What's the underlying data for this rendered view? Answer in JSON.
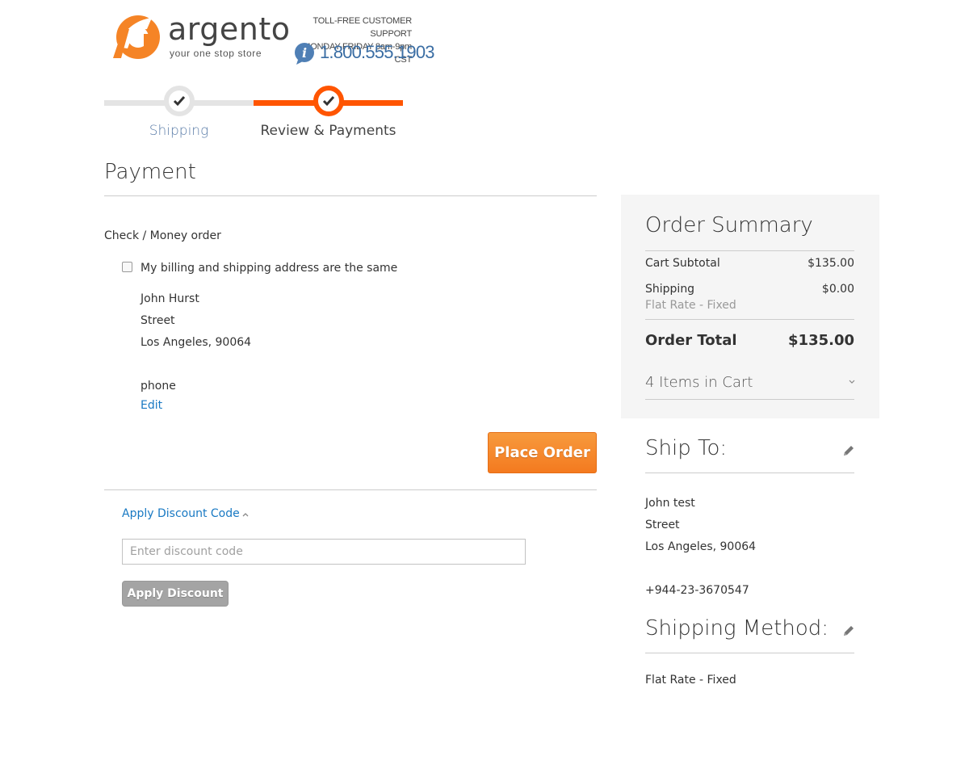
{
  "header": {
    "logo_word": "argento",
    "logo_tagline": "your one stop store",
    "support_line1": "TOLL-FREE CUSTOMER SUPPORT",
    "support_line2": "MONDAY-FRIDAY 8am-9pm CST",
    "support_phone": "1.800.555.1903",
    "brand_color": "#f58426",
    "phone_color": "#3b6ea4"
  },
  "progress": {
    "steps": [
      {
        "label": "Shipping",
        "state": "complete",
        "icon": "check-icon"
      },
      {
        "label": "Review & Payments",
        "state": "active",
        "icon": "check-icon"
      }
    ],
    "active_color": "#ff5501"
  },
  "payment": {
    "title": "Payment",
    "method_label": "Check / Money order",
    "same_address_label": "My billing and shipping address are the same",
    "same_address_checked": false,
    "billing_address": {
      "name": "John Hurst",
      "street": "Street",
      "city_zip": "Los Angeles, 90064",
      "blank": "",
      "phone": "phone"
    },
    "edit_label": "Edit",
    "place_order_label": "Place Order"
  },
  "discount": {
    "toggle_label": "Apply Discount Code",
    "input_placeholder": "Enter discount code",
    "input_value": "",
    "apply_label": "Apply Discount"
  },
  "summary": {
    "title": "Order Summary",
    "subtotal_label": "Cart Subtotal",
    "subtotal_value": "$135.00",
    "shipping_label": "Shipping",
    "shipping_value": "$0.00",
    "shipping_method": "Flat Rate - Fixed",
    "total_label": "Order Total",
    "total_value": "$135.00",
    "items_in_cart": "4 Items in Cart"
  },
  "ship_to": {
    "title": "Ship To:",
    "name": "John test",
    "street": "Street",
    "city_zip": "Los Angeles, 90064",
    "blank": "",
    "phone": "+944-23-3670547"
  },
  "shipping_method": {
    "title": "Shipping Method:",
    "value": "Flat Rate - Fixed"
  }
}
